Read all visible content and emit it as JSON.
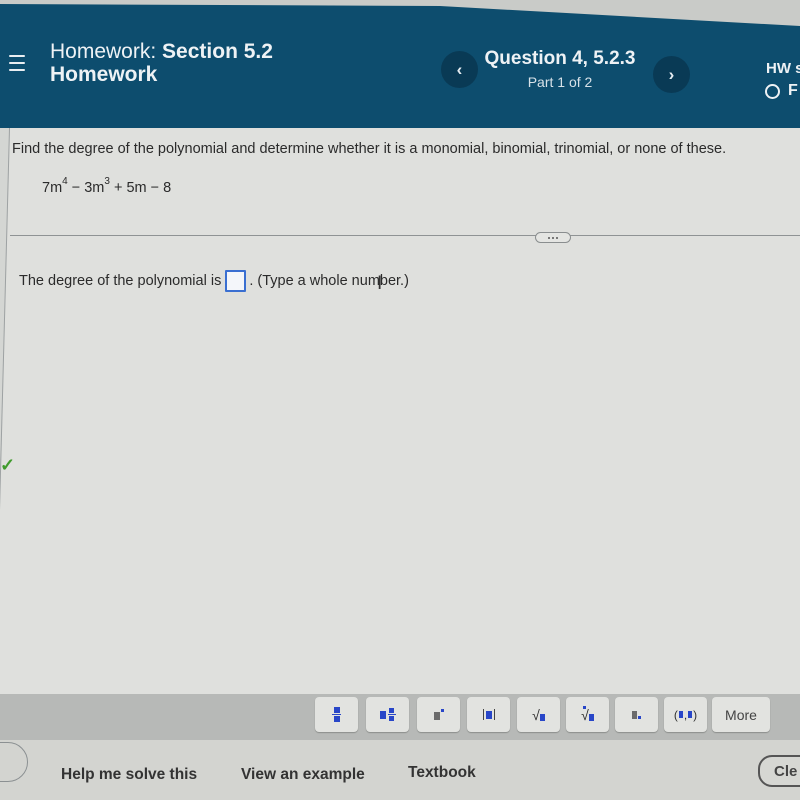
{
  "header": {
    "title_prefix": "Homework:",
    "title_bold": "Section 5.2",
    "title_line2": "Homework",
    "menu_icon": "hamburger-menu-icon",
    "question_title": "Question 4, 5.2.3",
    "question_part": "Part 1 of 2",
    "prev_icon": "‹",
    "next_icon": "›",
    "hw_score_label": "HW s",
    "hw_status_label": "F"
  },
  "question": {
    "instruction": "Find the degree of the polynomial and determine whether it is a monomial, binomial, trinomial, or none of these.",
    "polynomial": {
      "t1": "7m",
      "e1": "4",
      "t2": " − 3m",
      "e2": "3",
      "t3": " + 5m − 8"
    },
    "expand_icon": "ellipsis-icon"
  },
  "answer": {
    "prefix": "The degree of the polynomial is",
    "input_value": "",
    "suffix": ". (Type a whole number.)"
  },
  "toolbar": {
    "buttons": [
      {
        "name": "fraction",
        "label": ""
      },
      {
        "name": "mixed-number",
        "label": ""
      },
      {
        "name": "exponent",
        "label": ""
      },
      {
        "name": "absolute-value",
        "label": ""
      },
      {
        "name": "square-root",
        "label": ""
      },
      {
        "name": "nth-root",
        "label": ""
      },
      {
        "name": "subscript",
        "label": ""
      },
      {
        "name": "ordered-pair",
        "label": ""
      },
      {
        "name": "more",
        "label": "More"
      }
    ]
  },
  "help": {
    "help_me_solve": "Help me solve this",
    "view_example": "View an example",
    "textbook": "Textbook",
    "clear": "Cle"
  },
  "colors": {
    "header_bg": "#0d4d6e",
    "accent_blue": "#2846c8",
    "check_green": "#3f9b2c"
  }
}
